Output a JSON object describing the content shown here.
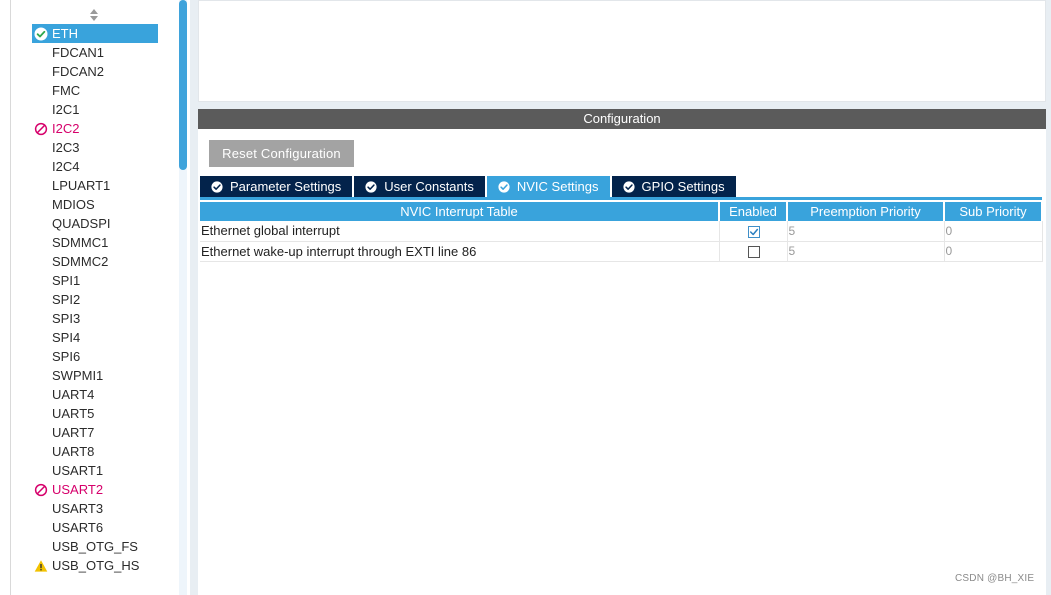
{
  "peripherals": [
    {
      "label": "ETH",
      "status": "ok",
      "selected": true
    },
    {
      "label": "FDCAN1",
      "status": "none"
    },
    {
      "label": "FDCAN2",
      "status": "none"
    },
    {
      "label": "FMC",
      "status": "none"
    },
    {
      "label": "I2C1",
      "status": "none"
    },
    {
      "label": "I2C2",
      "status": "error"
    },
    {
      "label": "I2C3",
      "status": "none"
    },
    {
      "label": "I2C4",
      "status": "none"
    },
    {
      "label": "LPUART1",
      "status": "none"
    },
    {
      "label": "MDIOS",
      "status": "none"
    },
    {
      "label": "QUADSPI",
      "status": "none"
    },
    {
      "label": "SDMMC1",
      "status": "none"
    },
    {
      "label": "SDMMC2",
      "status": "none"
    },
    {
      "label": "SPI1",
      "status": "none"
    },
    {
      "label": "SPI2",
      "status": "none"
    },
    {
      "label": "SPI3",
      "status": "none"
    },
    {
      "label": "SPI4",
      "status": "none"
    },
    {
      "label": "SPI6",
      "status": "none"
    },
    {
      "label": "SWPMI1",
      "status": "none"
    },
    {
      "label": "UART4",
      "status": "none"
    },
    {
      "label": "UART5",
      "status": "none"
    },
    {
      "label": "UART7",
      "status": "none"
    },
    {
      "label": "UART8",
      "status": "none"
    },
    {
      "label": "USART1",
      "status": "none"
    },
    {
      "label": "USART2",
      "status": "error"
    },
    {
      "label": "USART3",
      "status": "none"
    },
    {
      "label": "USART6",
      "status": "none"
    },
    {
      "label": "USB_OTG_FS",
      "status": "none"
    },
    {
      "label": "USB_OTG_HS",
      "status": "warning"
    }
  ],
  "config": {
    "header": "Configuration",
    "reset_label": "Reset Configuration",
    "tabs": [
      {
        "label": "Parameter Settings",
        "active": false
      },
      {
        "label": "User Constants",
        "active": false
      },
      {
        "label": "NVIC Settings",
        "active": true
      },
      {
        "label": "GPIO Settings",
        "active": false
      }
    ],
    "table": {
      "columns": [
        "NVIC Interrupt Table",
        "Enabled",
        "Preemption Priority",
        "Sub Priority"
      ],
      "rows": [
        {
          "name": "Ethernet global interrupt",
          "enabled": true,
          "preemption": "5",
          "sub": "0"
        },
        {
          "name": "Ethernet wake-up interrupt through EXTI line 86",
          "enabled": false,
          "preemption": "5",
          "sub": "0"
        }
      ]
    }
  },
  "watermark": "CSDN @BH_XIE",
  "colors": {
    "accent": "#39a3dc",
    "tab_dark": "#03234b",
    "ok": "#2fa84f",
    "error": "#d6006b",
    "warning": "#f2c200"
  }
}
